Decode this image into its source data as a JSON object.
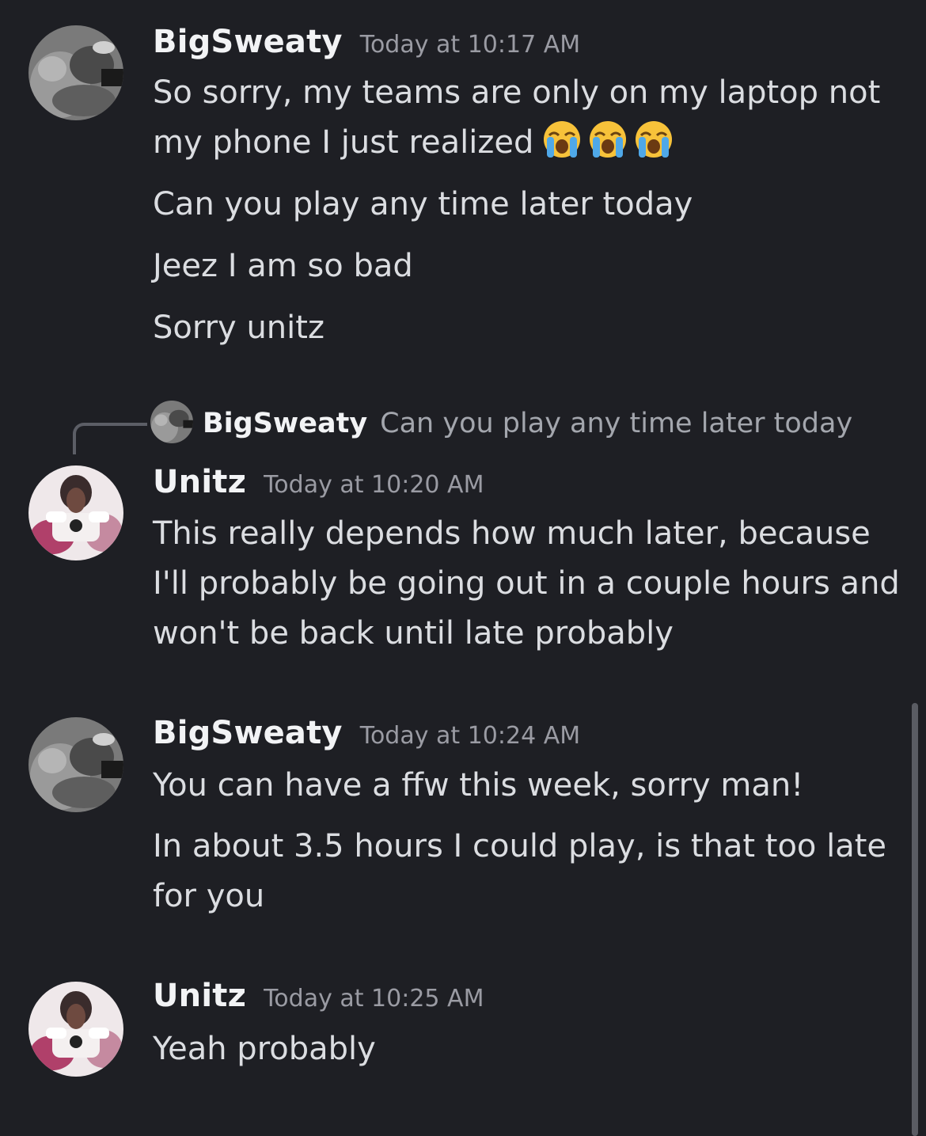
{
  "groups": [
    {
      "username": "BigSweaty",
      "timestamp": "Today at 10:17 AM",
      "messages": [
        "So sorry, my teams are only on my laptop not my phone I just realized",
        "Can you play any time later today",
        "Jeez I am so bad",
        "Sorry unitz"
      ],
      "emoji": [
        "loudly-crying-face",
        "loudly-crying-face",
        "loudly-crying-face"
      ]
    },
    {
      "reply_to": {
        "username": "BigSweaty",
        "text": "Can you play any time later today"
      },
      "username": "Unitz",
      "timestamp": "Today at 10:20 AM",
      "messages": [
        "This really depends how much later, because I'll probably be going out in a couple hours and won't be back until late probably"
      ]
    },
    {
      "username": "BigSweaty",
      "timestamp": "Today at 10:24 AM",
      "messages": [
        "You can have a ffw this week, sorry man!",
        "In about 3.5 hours I could play, is that too late for you"
      ]
    },
    {
      "username": "Unitz",
      "timestamp": "Today at 10:25 AM",
      "messages": [
        "Yeah probably"
      ]
    }
  ],
  "colors": {
    "background": "#1e1f24",
    "username": "#f2f3f5",
    "message_text": "#dbdde1",
    "timestamp": "#9a9ba3",
    "reply_text": "#a3a6ad"
  }
}
